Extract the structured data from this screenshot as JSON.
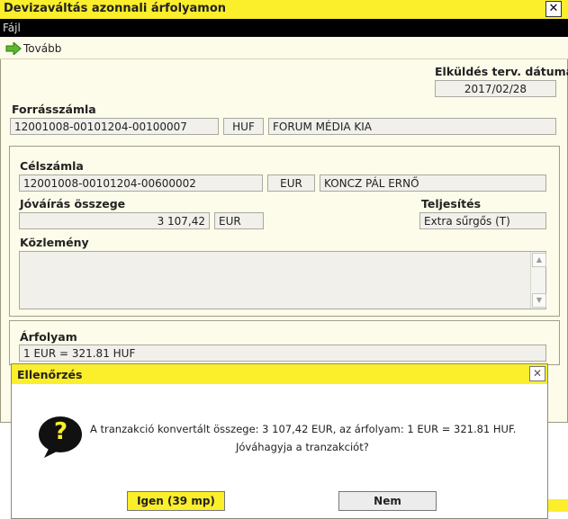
{
  "window": {
    "title": "Devizaváltás azonnali árfolyamon",
    "close": "✕"
  },
  "menu": {
    "file": "Fájl"
  },
  "toolbar": {
    "next_label": "Tovább"
  },
  "send_date": {
    "label": "Elküldés terv. dátuma",
    "value": "2017/02/28"
  },
  "source": {
    "label": "Forrásszámla",
    "account": "12001008-00101204-00100007",
    "currency": "HUF",
    "name": "FORUM MÉDIA KIA"
  },
  "target": {
    "label": "Célszámla",
    "account": "12001008-00101204-00600002",
    "currency": "EUR",
    "name": "KONCZ PÁL ERNŐ"
  },
  "credit": {
    "label": "Jóváírás összege",
    "amount": "3 107,42",
    "currency": "EUR"
  },
  "execution": {
    "label": "Teljesítés",
    "value": "Extra sűrgős (T)"
  },
  "memo": {
    "label": "Közlemény",
    "value": ""
  },
  "rate": {
    "label": "Árfolyam",
    "value": "1 EUR = 321.81 HUF"
  },
  "dialog": {
    "title": "Ellenőrzés",
    "close": "✕",
    "line1": "A tranzakció konvertált összege: 3 107,42 EUR, az árfolyam: 1 EUR = 321.81 HUF.",
    "line2": "Jóváhagyja a tranzakciót?",
    "yes": "Igen (39 mp)",
    "no": "Nem",
    "icon_glyph": "?"
  },
  "colors": {
    "accent": "#fbee2a",
    "form_bg": "#fdfbe9",
    "field_bg": "#f1f0ea"
  }
}
